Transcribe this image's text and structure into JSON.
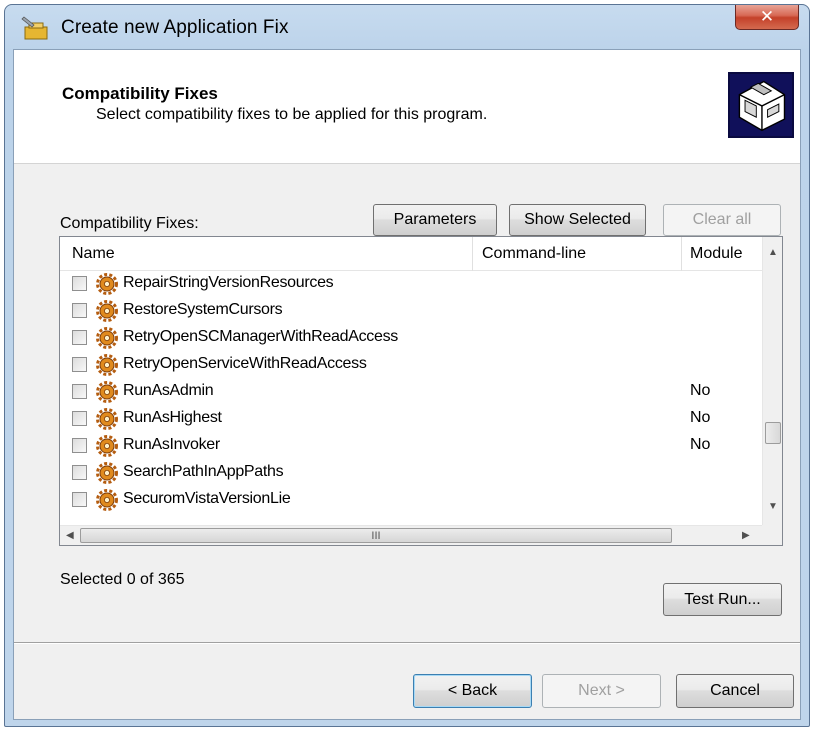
{
  "window": {
    "title": "Create new Application Fix",
    "close_glyph": "✕"
  },
  "header": {
    "title": "Compatibility Fixes",
    "subtitle": "Select compatibility fixes to be applied for this program.",
    "icon": "compatibility-box-icon"
  },
  "fixes_label": "Compatibility Fixes:",
  "toolbar": {
    "parameters_label": "Parameters",
    "show_selected_label": "Show Selected",
    "clear_all_label": "Clear all"
  },
  "list": {
    "columns": [
      "Name",
      "Command-line",
      "Module"
    ],
    "rows": [
      {
        "name": "RepairStringVersionResources",
        "module": "",
        "checked": false
      },
      {
        "name": "RestoreSystemCursors",
        "module": "",
        "checked": false
      },
      {
        "name": "RetryOpenSCManagerWithReadAccess",
        "module": "",
        "checked": false
      },
      {
        "name": "RetryOpenServiceWithReadAccess",
        "module": "",
        "checked": false
      },
      {
        "name": "RunAsAdmin",
        "module": "No",
        "checked": false
      },
      {
        "name": "RunAsHighest",
        "module": "No",
        "checked": false
      },
      {
        "name": "RunAsInvoker",
        "module": "No",
        "checked": false
      },
      {
        "name": "SearchPathInAppPaths",
        "module": "",
        "checked": false
      },
      {
        "name": "SecuromVistaVersionLie",
        "module": "",
        "checked": false
      }
    ],
    "hscroll_grip": "III"
  },
  "status_text": "Selected 0 of 365",
  "test_run_label": "Test Run...",
  "nav": {
    "back_label": "< Back",
    "next_label": "Next >",
    "cancel_label": "Cancel"
  },
  "colors": {
    "title_gradient": "#bcd3ea",
    "close_red": "#c4412a",
    "gear_orange": "#e08a1e"
  }
}
